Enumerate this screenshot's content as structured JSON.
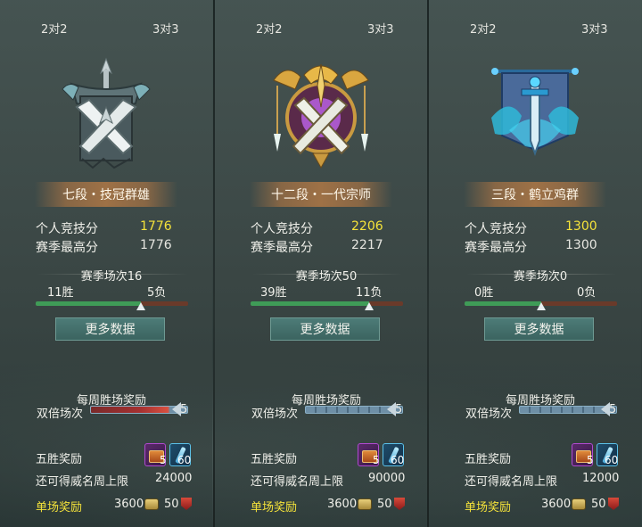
{
  "tabs": {
    "left": "2对2",
    "right": "3对3"
  },
  "labels": {
    "personal_score": "个人竞技分",
    "season_high": "赛季最高分",
    "more_data": "更多数据",
    "weekly_reward": "每周胜场奖励",
    "double_games": "双倍场次",
    "five_win_reward": "五胜奖励",
    "weekly_limit": "还可得威名周上限",
    "single_reward": "单场奖励"
  },
  "panels": [
    {
      "rank": "七段・技冠群雄",
      "personal_score": "1776",
      "season_high": "1776",
      "season_games": "赛季场次16",
      "wins": "11胜",
      "losses": "5负",
      "win_ratio": 0.6875,
      "double_count": "5",
      "chest_count": "5",
      "scroll_count": "60",
      "weekly_limit": "24000",
      "single_coin": "3600",
      "single_badge": "50"
    },
    {
      "rank": "十二段・一代宗师",
      "personal_score": "2206",
      "season_high": "2217",
      "season_games": "赛季场次50",
      "wins": "39胜",
      "losses": "11负",
      "win_ratio": 0.78,
      "double_count": "5",
      "chest_count": "5",
      "scroll_count": "60",
      "weekly_limit": "90000",
      "single_coin": "3600",
      "single_badge": "50"
    },
    {
      "rank": "三段・鹤立鸡群",
      "personal_score": "1300",
      "season_high": "1300",
      "season_games": "赛季场次0",
      "wins": "0胜",
      "losses": "0负",
      "win_ratio": 0.5,
      "double_count": "5",
      "chest_count": "5",
      "scroll_count": "60",
      "weekly_limit": "12000",
      "single_coin": "3600",
      "single_badge": "50"
    }
  ],
  "colors": {
    "accent_gold": "#f4e23a",
    "win_green": "#3f9c57",
    "loss_red": "#7a4330"
  }
}
